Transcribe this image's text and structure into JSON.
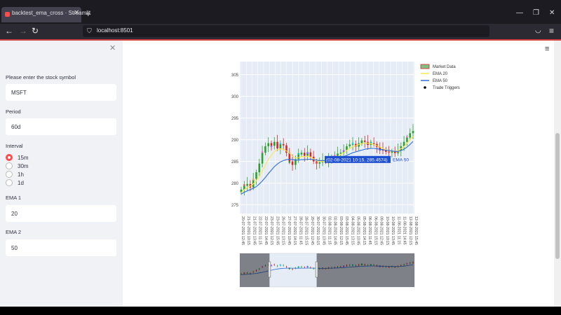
{
  "browser": {
    "tab_title": "backtest_ema_cross · Streamlit",
    "url": "localhost:8501"
  },
  "sidebar": {
    "symbol_label": "Please enter the stock symbol",
    "symbol_value": "MSFT",
    "period_label": "Period",
    "period_value": "60d",
    "interval_label": "Interval",
    "interval_options": [
      "15m",
      "30m",
      "1h",
      "1d"
    ],
    "interval_selected": "15m",
    "ema1_label": "EMA 1",
    "ema1_value": "20",
    "ema2_label": "EMA 2",
    "ema2_value": "50"
  },
  "chart_data": {
    "type": "candlestick",
    "ylim": [
      273,
      308
    ],
    "yticks": [
      275,
      280,
      285,
      290,
      295,
      300,
      305
    ],
    "xtick_labels": [
      "20-07-2021 12:45",
      "21-07-2021 10:15",
      "21-07-2021 13:45",
      "22-07-2021 11:15",
      "22-07-2021 14:45",
      "23-07-2021 12:15",
      "23-07-2021 15:45",
      "26-07-2021 13:15",
      "27-07-2021 10:45",
      "27-07-2021 14:15",
      "28-07-2021 11:45",
      "28-07-2021 15:15",
      "29-07-2021 12:45",
      "30-07-2021 10:15",
      "30-07-2021 13:45",
      "02-08-2021 11:15",
      "02-08-2021 14:45",
      "03-08-2021 12:15",
      "03-08-2021 15:45",
      "04-08-2021 13:15",
      "05-08-2021 10:45",
      "05-08-2021 14:15",
      "06-08-2021 11:45",
      "06-08-2021 15:15",
      "09-08-2021 12:45",
      "10-08-2021 10:15",
      "10-08-2021 13:45",
      "11-08-2021 11:15",
      "11-08-2021 14:45",
      "12-08-2021 12:15",
      "12-08-2021 15:45"
    ],
    "legend": [
      "Market Data",
      "EMA 20",
      "EMA 50",
      "Trade Triggers"
    ],
    "legend_position": "top-right",
    "close_series": [
      278.5,
      279.4,
      279.8,
      279.0,
      281.0,
      282.5,
      284.5,
      287.0,
      288.5,
      289.2,
      288.6,
      289.5,
      288.0,
      289.0,
      288.7,
      287.0,
      285.0,
      284.2,
      285.5,
      286.6,
      287.0,
      286.3,
      287.1,
      286.1,
      285.0,
      284.5,
      284.8,
      285.3,
      285.0,
      285.6,
      286.0,
      286.2,
      286.8,
      287.0,
      287.6,
      288.5,
      288.9,
      289.0,
      288.4,
      289.2,
      289.8,
      289.5,
      288.8,
      289.2,
      289.0,
      288.3,
      287.8,
      287.5,
      287.2,
      287.0,
      287.3,
      286.9,
      287.5,
      288.5,
      289.5,
      290.5,
      291.5,
      292.0
    ],
    "ema20": [
      277.8,
      278.5,
      279.0,
      279.3,
      279.8,
      280.5,
      281.5,
      282.8,
      284.2,
      285.5,
      286.5,
      287.3,
      287.7,
      287.9,
      287.8,
      287.4,
      286.9,
      286.2,
      285.8,
      285.9,
      286.1,
      286.1,
      286.2,
      286.0,
      285.6,
      285.2,
      285.0,
      285.0,
      285.1,
      285.2,
      285.5,
      285.8,
      286.2,
      286.6,
      287.0,
      287.5,
      288.0,
      288.4,
      288.6,
      288.9,
      289.1,
      289.2,
      289.2,
      289.1,
      288.9,
      288.6,
      288.3,
      288.0,
      287.7,
      287.5,
      287.4,
      287.3,
      287.5,
      287.9,
      288.4,
      289.2,
      290.0,
      290.8
    ],
    "ema50": [
      277.5,
      277.9,
      278.2,
      278.5,
      278.8,
      279.2,
      279.8,
      280.5,
      281.3,
      282.2,
      283.0,
      283.8,
      284.4,
      284.9,
      285.2,
      285.4,
      285.5,
      285.4,
      285.3,
      285.3,
      285.4,
      285.4,
      285.5,
      285.5,
      285.4,
      285.3,
      285.2,
      285.2,
      285.2,
      285.3,
      285.4,
      285.5,
      285.7,
      285.9,
      286.1,
      286.4,
      286.7,
      287.0,
      287.2,
      287.4,
      287.6,
      287.8,
      287.9,
      288.0,
      288.0,
      287.9,
      287.8,
      287.7,
      287.6,
      287.5,
      287.4,
      287.3,
      287.3,
      287.5,
      287.8,
      288.3,
      288.9,
      289.6
    ],
    "hover_label": "(02-08-2021 10:15, 285.4574)",
    "hover_series": "EMA 50",
    "rangeslider_window": [
      0.17,
      0.44
    ]
  }
}
